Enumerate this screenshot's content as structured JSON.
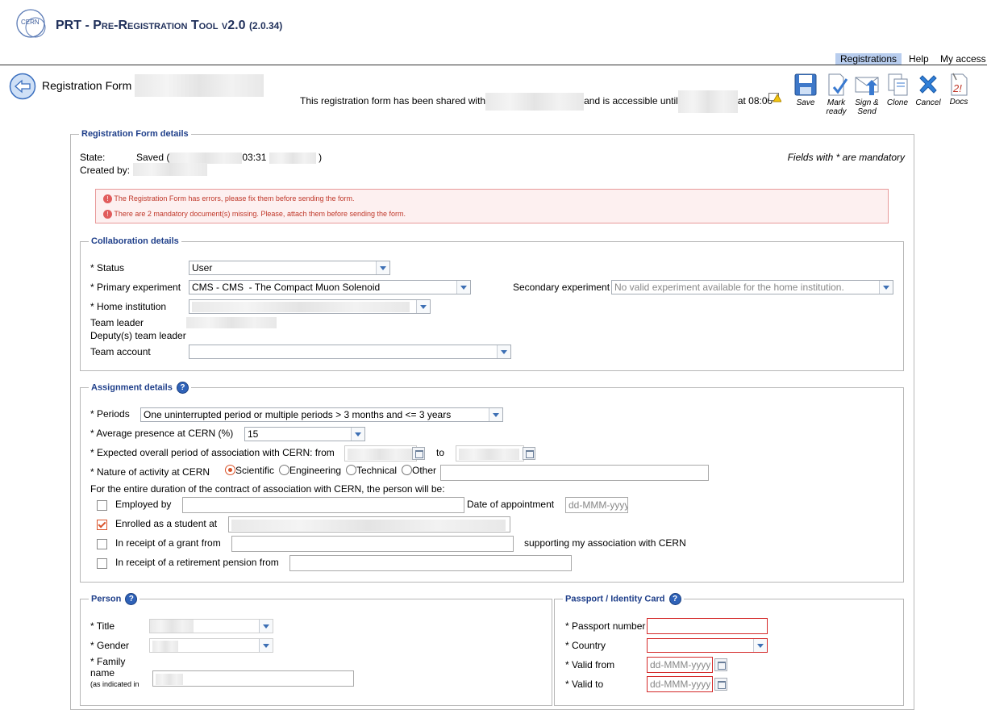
{
  "header": {
    "title_main": "PRT - Pre-Registration Tool v2.0",
    "version": "(2.0.34)",
    "logo_text": "CERN"
  },
  "topnav": {
    "items": [
      {
        "label": "Registrations",
        "active": true
      },
      {
        "label": "Help",
        "active": false
      },
      {
        "label": "My access",
        "active": false
      }
    ]
  },
  "titlebar": {
    "page_title": "Registration Form",
    "shared_prefix": "This registration form has been shared with",
    "shared_mid": "and is accessible until",
    "shared_suffix": "at 08:00"
  },
  "toolbar": {
    "save": "Save",
    "mark_ready_1": "Mark",
    "mark_ready_2": "ready",
    "sign_send_1": "Sign &",
    "sign_send_2": "Send",
    "clone": "Clone",
    "cancel": "Cancel",
    "docs": "Docs"
  },
  "form": {
    "legend": "Registration Form details",
    "state_label": "State:",
    "state_value_prefix": "Saved (",
    "state_time": "03:31",
    "state_suffix": ")",
    "created_label": "Created by:",
    "mandatory_note": "Fields with * are mandatory",
    "errors": [
      "The Registration Form has errors, please fix them before sending the form.",
      "There are 2 mandatory document(s) missing. Please, attach them before sending the form."
    ]
  },
  "collab": {
    "legend": "Collaboration details",
    "status_label": "* Status",
    "status_value": "User",
    "primary_label": "* Primary experiment",
    "primary_value": "CMS - CMS  - The Compact Muon Solenoid",
    "secondary_label": "Secondary experiment",
    "secondary_value": "No valid experiment available for the home institution.",
    "home_label": "* Home institution",
    "team_leader_label": "Team leader",
    "deputy_label": "Deputy(s) team leader",
    "team_account_label": "Team account"
  },
  "assignment": {
    "legend": "Assignment details",
    "periods_label": "* Periods",
    "periods_value": "One uninterrupted period or multiple periods > 3 months and <= 3 years",
    "presence_label": "* Average presence at CERN (%)",
    "presence_value": "15",
    "expected_label": "* Expected overall period of association with CERN: from",
    "to_label": "to",
    "nature_label": "* Nature of activity at CERN",
    "nature_options": [
      "Scientific",
      "Engineering",
      "Technical",
      "Other"
    ],
    "duration_text": "For the entire duration of the contract of association with CERN, the person will be:",
    "employed_label": "Employed by",
    "appointment_label": "Date of appointment",
    "date_placeholder": "dd-MMM-yyyy",
    "student_label": "Enrolled as a student at",
    "grant_label": "In receipt of a grant from",
    "grant_suffix": "supporting my association with CERN",
    "pension_label": "In receipt of a retirement pension from"
  },
  "person": {
    "legend": "Person",
    "title_label": "* Title",
    "gender_label": "* Gender",
    "family_label_1": "* Family",
    "family_label_2": "name",
    "family_note": "(as indicated in"
  },
  "passport": {
    "legend": "Passport / Identity Card",
    "number_label": "* Passport number",
    "country_label": "* Country",
    "valid_from_label": "* Valid from",
    "valid_to_label": "* Valid to",
    "date_placeholder": "dd-MMM-yyyy"
  },
  "colors": {
    "legend_blue": "#1f3f8a",
    "error_border": "#d42a2a",
    "error_bg": "#fdf0f0",
    "nav_active": "#b8cdee"
  }
}
